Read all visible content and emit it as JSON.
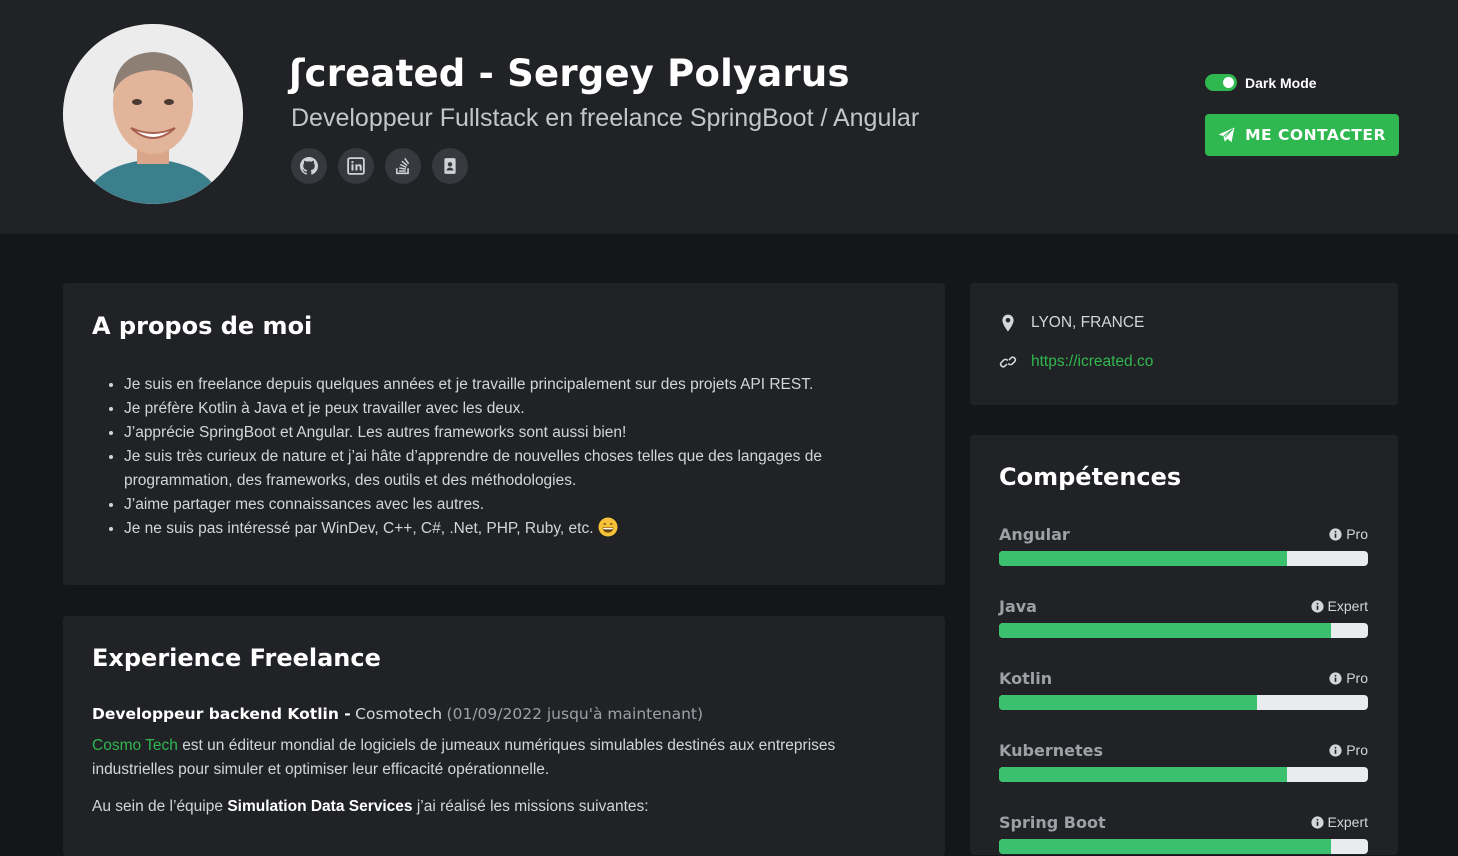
{
  "header": {
    "title": "ʃcreated - Sergey Polyarus",
    "subtitle": "Developpeur Fullstack en freelance SpringBoot / Angular",
    "social_icons": [
      "github-icon",
      "linkedin-icon",
      "stackoverflow-icon",
      "contact-card-icon"
    ],
    "dark_mode_label": "Dark Mode",
    "dark_mode_on": true,
    "contact_label": "ME CONTACTER",
    "accent_color": "#2fb84f"
  },
  "about": {
    "title": "A propos de moi",
    "items": [
      "Je suis en freelance depuis quelques années et je travaille principalement sur des projets API REST.",
      "Je préfère Kotlin à Java et je peux travailler avec les deux.",
      "J’apprécie SpringBoot et Angular. Les autres frameworks sont aussi bien!",
      "Je suis très curieux de nature et j’ai hâte d’apprendre de nouvelles choses telles que des langages de programmation, des frameworks, des outils et des méthodologies.",
      "J’aime partager mes connaissances avec les autres.",
      "Je ne suis pas intéressé par WinDev, C++, C#, .Net, PHP, Ruby, etc."
    ]
  },
  "experience": {
    "title": "Experience Freelance",
    "role": "Developpeur backend Kotlin -",
    "company": "Cosmotech",
    "period": "(01/09/2022 jusqu'à maintenant)",
    "company_link": "Cosmo Tech",
    "description": "est un éditeur mondial de logiciels de jumeaux numériques simulables destinés aux entreprises industrielles pour simuler et optimiser leur efficacité opérationnelle.",
    "team_prefix": "Au sein de l’équipe",
    "team_name": "Simulation Data Services",
    "team_suffix": "j’ai réalisé les missions suivantes:"
  },
  "location": {
    "city": "LYON, FRANCE",
    "website": "https://icreated.co"
  },
  "skills": {
    "title": "Compétences",
    "items": [
      {
        "name": "Angular",
        "level": "Pro",
        "value": 0.78
      },
      {
        "name": "Java",
        "level": "Expert",
        "value": 0.9
      },
      {
        "name": "Kotlin",
        "level": "Pro",
        "value": 0.7
      },
      {
        "name": "Kubernetes",
        "level": "Pro",
        "value": 0.78
      },
      {
        "name": "Spring Boot",
        "level": "Expert",
        "value": 0.9
      }
    ]
  }
}
